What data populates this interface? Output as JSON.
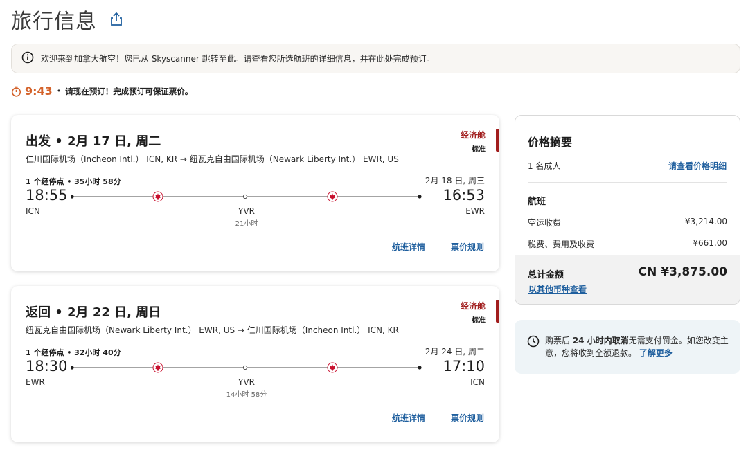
{
  "page": {
    "title": "旅行信息"
  },
  "banner": {
    "text": "欢迎来到加拿大航空！您已从 Skyscanner 跳转至此。请查看您所选航班的详细信息，并在此处完成预订。"
  },
  "timer": {
    "value": "9:43",
    "separator": "•",
    "message": "请现在预订！完成预订可保证票价。"
  },
  "flights": [
    {
      "heading": "出发 • 2月 17 日, 周二",
      "route": "仁川国际机场（Incheon Intl.） ICN, KR → 纽瓦克自由国际机场（Newark Liberty Int.） EWR, US",
      "cabin": "经济舱",
      "fare_type": "标准",
      "stops": "1 个经停点 • 35小时 58分",
      "arrival_date": "2月 18 日, 周三",
      "departure_time": "18:55",
      "arrival_time": "16:53",
      "departure_code": "ICN",
      "arrival_code": "EWR",
      "via_code": "YVR",
      "via_duration": "21小时",
      "details_link": "航班详情",
      "rules_link": "票价规则"
    },
    {
      "heading": "返回 • 2月 22 日, 周日",
      "route": "纽瓦克自由国际机场（Newark Liberty Int.） EWR, US → 仁川国际机场（Incheon Intl.） ICN, KR",
      "cabin": "经济舱",
      "fare_type": "标准",
      "stops": "1 个经停点 • 32小时 40分",
      "arrival_date": "2月 24 日, 周二",
      "departure_time": "18:30",
      "arrival_time": "17:10",
      "departure_code": "EWR",
      "arrival_code": "ICN",
      "via_code": "YVR",
      "via_duration": "14小时 58分",
      "details_link": "航班详情",
      "rules_link": "票价规则"
    }
  ],
  "summary": {
    "title": "价格摘要",
    "passengers": "1 名成人",
    "breakdown_link": "请查看价格明细",
    "section_title": "航班",
    "fees": [
      {
        "label": "空运收费",
        "value": "¥3,214.00"
      },
      {
        "label": "税费、费用及收费",
        "value": "¥661.00"
      }
    ],
    "total_label": "总计金额",
    "total_value": "CN ¥3,875.00",
    "currency_link": "以其他币种查看"
  },
  "policy": {
    "text_before": "购票后 ",
    "text_strong": "24 小时内取消",
    "text_after": "无需支付罚金。如您改变主意，您将收到全额退款。",
    "link": "了解更多"
  },
  "colors": {
    "accent_red": "#a11d1d",
    "timer_orange": "#d4622a",
    "link_blue": "#1f5f9e"
  },
  "icons": {
    "share": "share-icon",
    "info": "info-icon",
    "timer": "timer-icon",
    "maple_leaf": "maple-leaf-icon",
    "clock": "clock-icon"
  }
}
